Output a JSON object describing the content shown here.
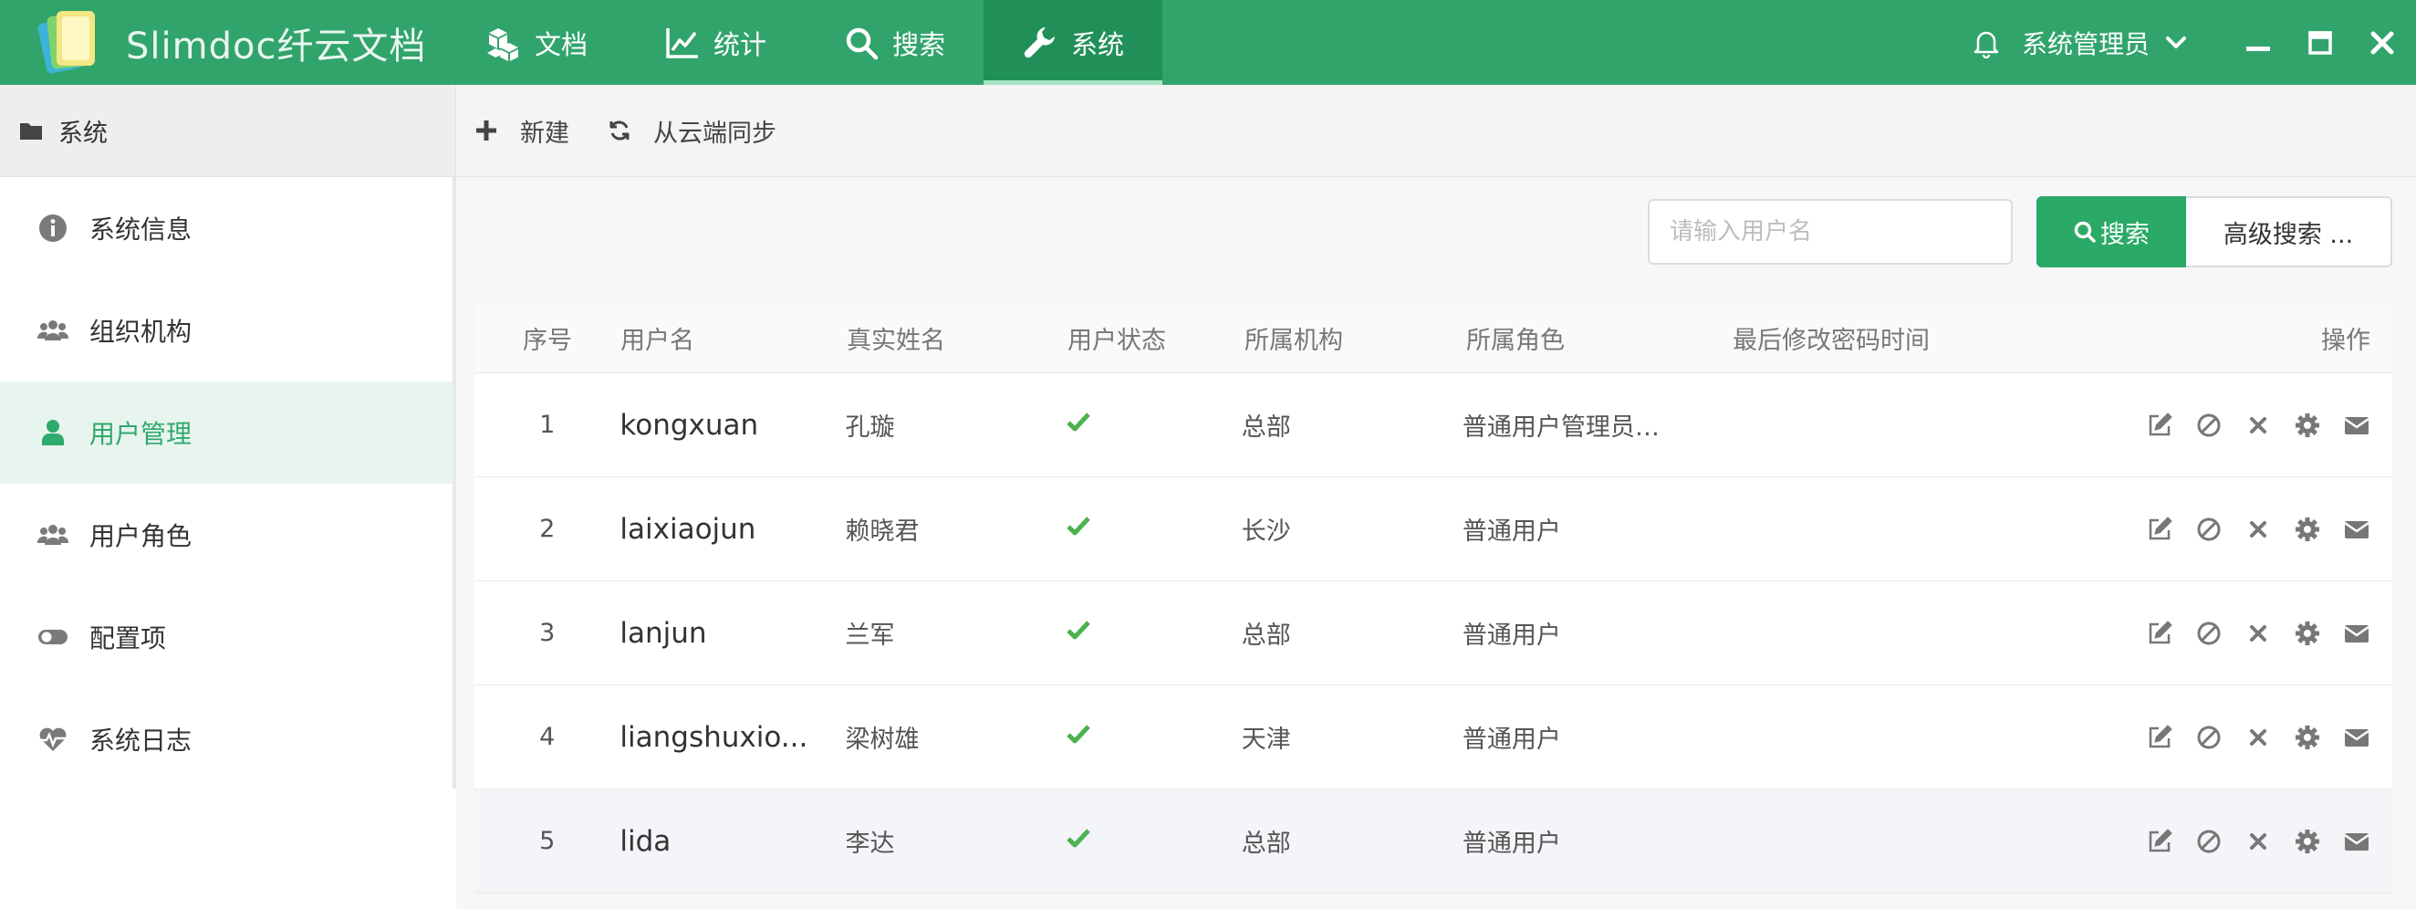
{
  "app": {
    "brand": "Slimdoc纤云文档",
    "nav": [
      {
        "label": "文档",
        "icon": "cubes-icon"
      },
      {
        "label": "统计",
        "icon": "line-chart-icon"
      },
      {
        "label": "搜索",
        "icon": "search-icon"
      },
      {
        "label": "系统",
        "icon": "wrench-icon",
        "active": true
      }
    ],
    "user": "系统管理员"
  },
  "sidebar": {
    "header": "系统",
    "items": [
      {
        "label": "系统信息",
        "icon": "info-circle-icon"
      },
      {
        "label": "组织机构",
        "icon": "users-group-icon"
      },
      {
        "label": "用户管理",
        "icon": "user-icon",
        "active": true
      },
      {
        "label": "用户角色",
        "icon": "users-group-icon"
      },
      {
        "label": "配置项",
        "icon": "toggle-icon"
      },
      {
        "label": "系统日志",
        "icon": "heartbeat-icon"
      }
    ]
  },
  "toolbar": {
    "new_label": "新建",
    "sync_label": "从云端同步"
  },
  "search": {
    "placeholder": "请输入用户名",
    "button": "搜索",
    "advanced": "高级搜索 ..."
  },
  "table": {
    "columns": [
      "序号",
      "用户名",
      "真实姓名",
      "用户状态",
      "所属机构",
      "所属角色",
      "最后修改密码时间",
      "操作"
    ],
    "rows": [
      {
        "no": "1",
        "username": "kongxuan",
        "realname": "孔璇",
        "org": "总部",
        "role": "普通用户管理员…",
        "pwd_time": ""
      },
      {
        "no": "2",
        "username": "laixiaojun",
        "realname": "赖晓君",
        "org": "长沙",
        "role": "普通用户",
        "pwd_time": ""
      },
      {
        "no": "3",
        "username": "lanjun",
        "realname": "兰军",
        "org": "总部",
        "role": "普通用户",
        "pwd_time": ""
      },
      {
        "no": "4",
        "username": "liangshuxio...",
        "realname": "梁树雄",
        "org": "天津",
        "role": "普通用户",
        "pwd_time": ""
      },
      {
        "no": "5",
        "username": "lida",
        "realname": "李达",
        "org": "总部",
        "role": "普通用户",
        "pwd_time": ""
      }
    ],
    "row_actions": [
      "edit-icon",
      "ban-icon",
      "delete-icon",
      "settings-icon",
      "mail-icon"
    ]
  },
  "colors": {
    "primary": "#31a46c",
    "nav_active": "#219058",
    "sidebar_active_bg": "#e8f4ee",
    "sidebar_active_text": "#2eaa6c",
    "status_ok": "#4cb34f"
  }
}
